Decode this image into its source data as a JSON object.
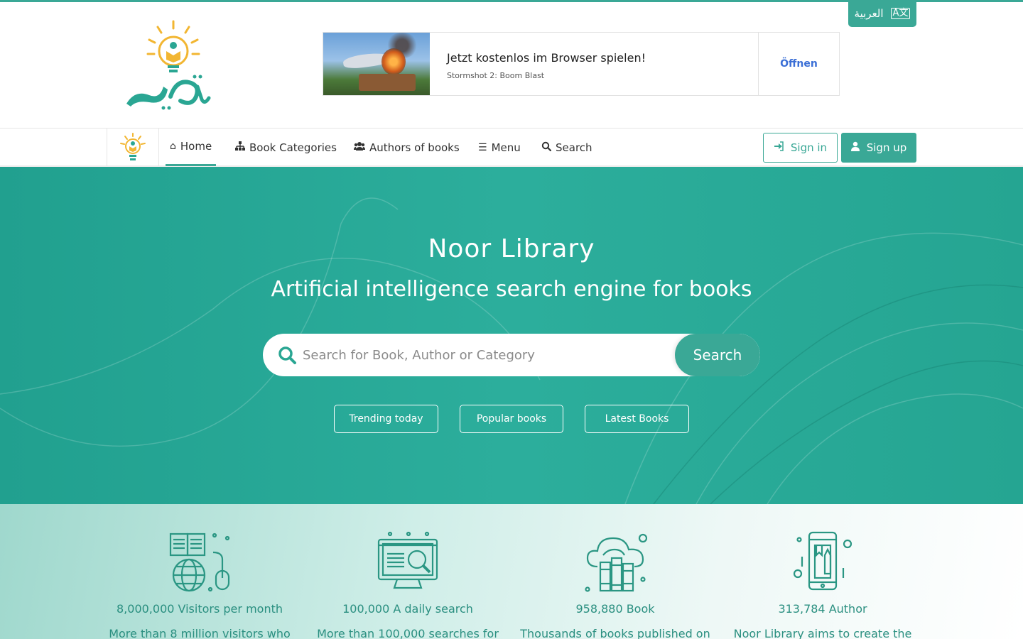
{
  "header": {
    "language_toggle": "العربية",
    "logo_alt": "مكتبة نور"
  },
  "ad": {
    "title": "Jetzt kostenlos im Browser spielen!",
    "subtitle": "Stormshot 2: Boom Blast",
    "cta": "Öffnen"
  },
  "nav": {
    "items": [
      {
        "label": "Home",
        "icon": "home-icon"
      },
      {
        "label": "Book Categories",
        "icon": "sitemap-icon"
      },
      {
        "label": "Authors of books",
        "icon": "users-icon"
      },
      {
        "label": "Menu",
        "icon": "bars-icon"
      },
      {
        "label": "Search",
        "icon": "search-icon"
      }
    ],
    "active": "Home",
    "sign_in": "Sign in",
    "sign_up": "Sign up"
  },
  "hero": {
    "title": "Noor Library",
    "subtitle": "Artificial intelligence search engine for books",
    "search_placeholder": "Search for Book, Author or Category",
    "search_button": "Search",
    "quick_links": [
      "Trending today",
      "Popular books",
      "Latest Books"
    ]
  },
  "stats": [
    {
      "icon": "globe-book-icon",
      "count": "8,000,000 Visitors per month",
      "desc": "More than 8 million visitors who"
    },
    {
      "icon": "monitor-search-icon",
      "count": "100,000 A daily search",
      "desc": "More than 100,000 searches for"
    },
    {
      "icon": "cloud-books-icon",
      "count": "958,880 Book",
      "desc": "Thousands of books published on"
    },
    {
      "icon": "mobile-book-icon",
      "count": "313,784 Author",
      "desc": "Noor Library aims to create the"
    }
  ],
  "colors": {
    "brand": "#3aa896",
    "hero_bg": "#2cae9c",
    "stat_text": "#2a8f80",
    "ad_cta": "#3b6fd6"
  }
}
